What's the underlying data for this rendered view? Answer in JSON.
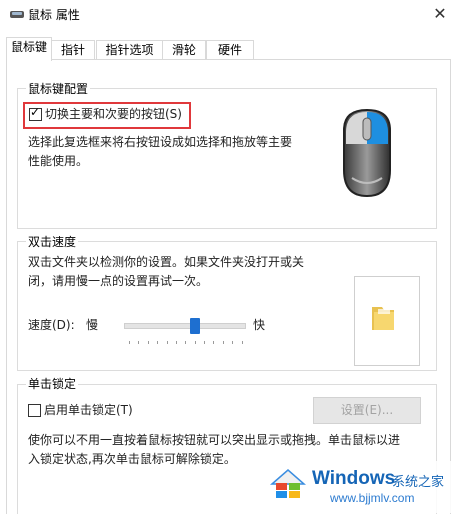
{
  "window": {
    "title": "鼠标 属性",
    "close_glyph": "✕"
  },
  "tabs": [
    "鼠标键",
    "指针",
    "指针选项",
    "滑轮",
    "硬件"
  ],
  "button_config": {
    "group_title": "鼠标键配置",
    "switch_label": "切换主要和次要的按钮(S)",
    "switch_checked": true,
    "description_line1": "选择此复选框来将右按钮设成如选择和拖放等主要",
    "description_line2": "性能使用。"
  },
  "double_click": {
    "group_title": "双击速度",
    "description_line1": "双击文件夹以检测你的设置。如果文件夹没打开或关",
    "description_line2": "闭，请用慢一点的设置再试一次。",
    "speed_label": "速度(D):",
    "slow_label": "慢",
    "fast_label": "快",
    "speed_fraction": 0.58
  },
  "click_lock": {
    "group_title": "单击锁定",
    "enable_label": "启用单击锁定(T)",
    "enable_checked": false,
    "settings_label": "设置(E)...",
    "description_line1": "使你可以不用一直按着鼠标按钮就可以突出显示或拖拽。单击鼠标以进",
    "description_line2": "入锁定状态,再次单击鼠标可解除锁定。"
  },
  "watermark": {
    "brand": "Windows",
    "sub": "系统之家",
    "url": "www.bjjmlv.com"
  },
  "colors": {
    "accent": "#1e6fd0",
    "highlight": "#e0383b",
    "watermark_blue": "#1565b6"
  }
}
